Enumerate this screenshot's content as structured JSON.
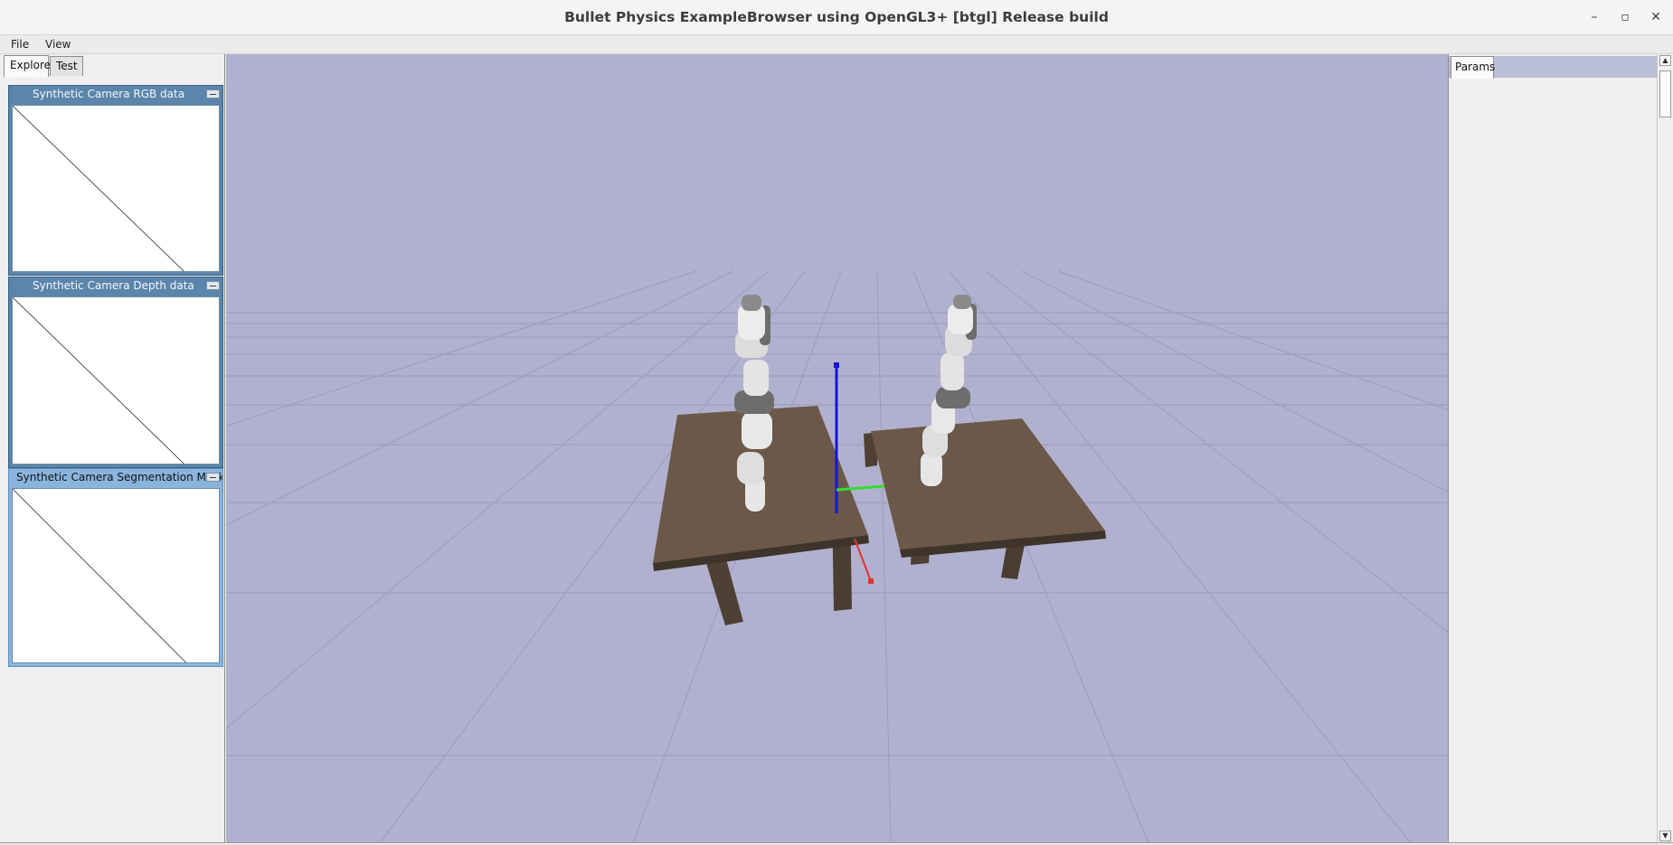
{
  "window": {
    "title": "Bullet Physics ExampleBrowser using OpenGL3+ [btgl] Release build",
    "controls": {
      "minimize": "–",
      "restore": "▫",
      "close": "✕"
    }
  },
  "menu": {
    "items": [
      "File",
      "View"
    ]
  },
  "left_panel": {
    "tabs": [
      "Explorer",
      "Test"
    ],
    "camera_windows": [
      {
        "title": "Synthetic Camera RGB data"
      },
      {
        "title": "Synthetic Camera Depth data"
      },
      {
        "title": "Synthetic Camera Segmentation Mask"
      }
    ]
  },
  "right_panel": {
    "tabs": [
      "Params"
    ]
  },
  "scrollbar": {
    "up_arrow": "▲",
    "down_arrow": "▼"
  },
  "colors": {
    "viewport_bg": "#b1b1cf",
    "grid": "#9c9cb8",
    "table_top": "#6b5848",
    "table_leg": "#4e4034",
    "robot_body": "#e6e6e6",
    "robot_joint": "#6d6d6d",
    "axis_x": "#e53030",
    "axis_y": "#33dd33",
    "axis_z": "#1515d8"
  }
}
